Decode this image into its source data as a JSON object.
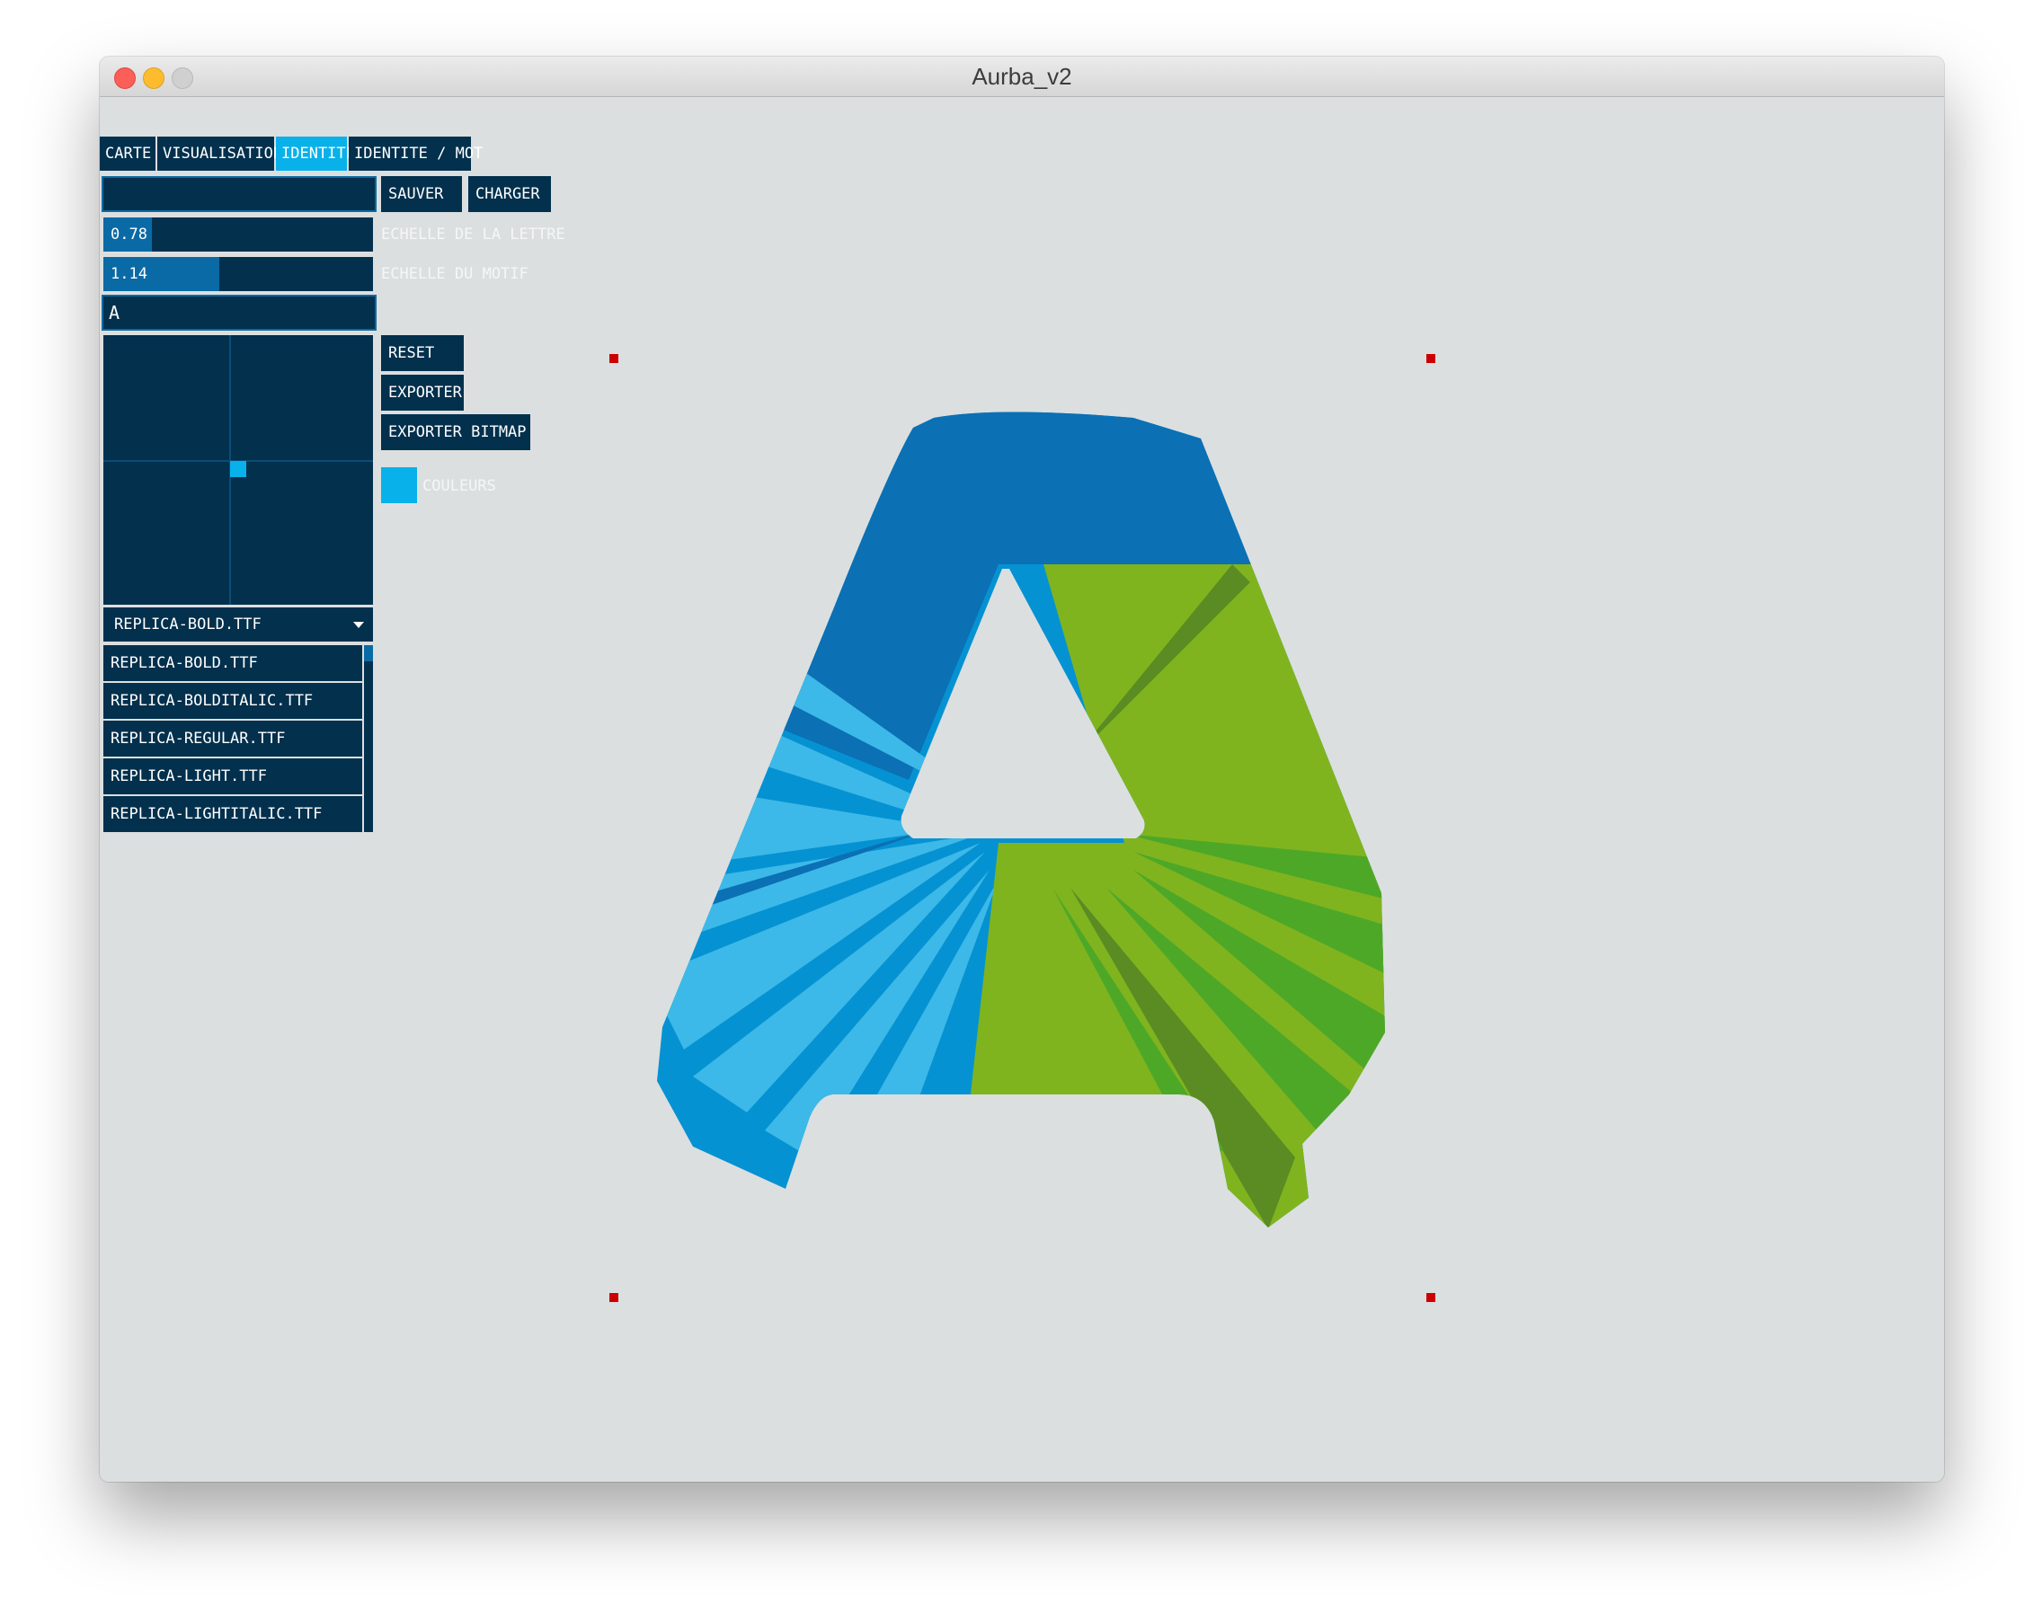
{
  "window": {
    "title": "Aurba_v2"
  },
  "tabs": [
    {
      "label": "CARTE",
      "active": false
    },
    {
      "label": "VISUALISATION",
      "active": false
    },
    {
      "label": "IDENTITE",
      "active": true
    },
    {
      "label": "IDENTITE / MOT",
      "active": false
    }
  ],
  "file_controls": {
    "name_value": "",
    "save_label": "SAUVER",
    "load_label": "CHARGER"
  },
  "sliders": {
    "letter_scale": {
      "value": "0.78",
      "label": "ECHELLE DE LA LETTRE",
      "fill_fraction": 0.18
    },
    "pattern_scale": {
      "value": "1.14",
      "label": "ECHELLE DU MOTIF",
      "fill_fraction": 0.43
    }
  },
  "letter_input": {
    "value": "A"
  },
  "actions": {
    "reset_label": "RESET",
    "export_label": "EXPORTER",
    "export_bitmap_label": "EXPORTER BITMAP",
    "colors_label": "COULEURS"
  },
  "font_select": {
    "selected": "REPLICA-BOLD.TTF",
    "options": [
      "REPLICA-BOLD.TTF",
      "REPLICA-BOLDITALIC.TTF",
      "REPLICA-REGULAR.TTF",
      "REPLICA-LIGHT.TTF",
      "REPLICA-LIGHTITALIC.TTF"
    ]
  },
  "colors": {
    "panel": "#02304d",
    "accent": "#08b1ea",
    "slider_fill": "#0a6aa5",
    "canvas": "#dcdfe0",
    "handle": "#cc0000",
    "letter_blue_dark": "#0b70b4",
    "letter_blue_mid": "#0592d2",
    "letter_blue_light": "#3cb9e8",
    "letter_green_light": "#80b41e",
    "letter_green_mid": "#4ea828",
    "letter_green_dark": "#5a8c23"
  },
  "icons": {
    "dropdown_caret": "chevron-down-icon"
  }
}
